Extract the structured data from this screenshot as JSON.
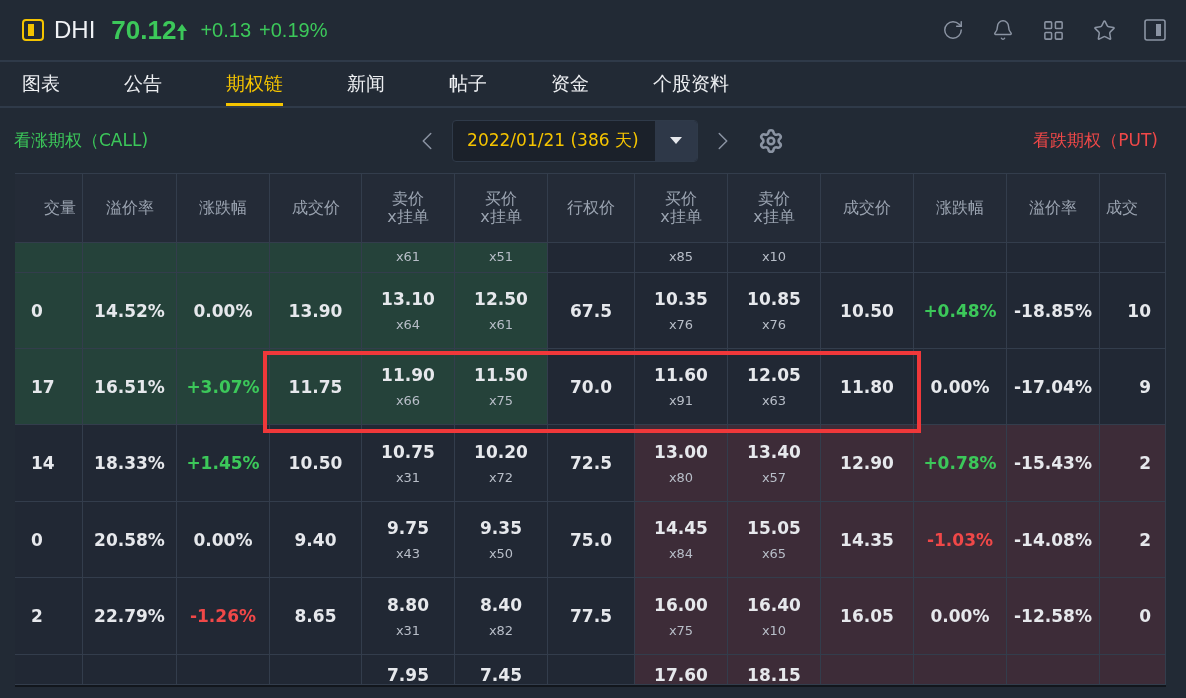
{
  "quote": {
    "symbol": "DHI",
    "price": "70.12",
    "rising": true,
    "color": "#3cc85a",
    "change": "+0.13",
    "change_percent": "+0.19%"
  },
  "tabs": [
    {
      "label": "图表",
      "selected": false
    },
    {
      "label": "公告",
      "selected": false
    },
    {
      "label": "期权链",
      "selected": true
    },
    {
      "label": "新闻",
      "selected": false
    },
    {
      "label": "帖子",
      "selected": false
    },
    {
      "label": "资金",
      "selected": false
    },
    {
      "label": "个股资料",
      "selected": false
    }
  ],
  "toolbar": {
    "call_label": "看涨期权（CALL)",
    "expiry": "2022/01/21 (386 天)",
    "put_label": "看跌期权（PUT)"
  },
  "table": {
    "columns": [
      {
        "label": "交量"
      },
      {
        "label": "溢价率"
      },
      {
        "label": "涨跌幅"
      },
      {
        "label": "成交价"
      },
      {
        "label": "卖价\nx挂单"
      },
      {
        "label": "买价\nx挂单"
      },
      {
        "label": "行权价"
      },
      {
        "label": "买价\nx挂单"
      },
      {
        "label": "卖价\nx挂单"
      },
      {
        "label": "成交价"
      },
      {
        "label": "涨跌幅"
      },
      {
        "label": "溢价率"
      },
      {
        "label": "成交"
      }
    ],
    "rows": [
      {
        "kind": "top_cut",
        "call_itm": true,
        "put_itm": false,
        "call": {
          "ask": {
            "size": "x61"
          },
          "bid": {
            "size": "x51"
          }
        },
        "put": {
          "bid": {
            "size": "x85"
          },
          "ask": {
            "size": "x10"
          }
        }
      },
      {
        "kind": "full",
        "call_itm": true,
        "put_itm": false,
        "call": {
          "volume": "0",
          "premium": "14.52%",
          "change": {
            "text": "0.00%",
            "color": "#e6e8ec"
          },
          "last": "13.90",
          "ask": {
            "price": "13.10",
            "size": "x64"
          },
          "bid": {
            "price": "12.50",
            "size": "x61"
          }
        },
        "strike": "67.5",
        "put": {
          "bid": {
            "price": "10.35",
            "size": "x76"
          },
          "ask": {
            "price": "10.85",
            "size": "x76"
          },
          "last": "10.50",
          "change": {
            "text": "+0.48%",
            "color": "#3cc85a"
          },
          "premium": "-18.85%",
          "volume": "10"
        }
      },
      {
        "kind": "full",
        "call_itm": true,
        "put_itm": false,
        "highlighted": true,
        "call": {
          "volume": "17",
          "premium": "16.51%",
          "change": {
            "text": "+3.07%",
            "color": "#3cc85a"
          },
          "last": "11.75",
          "ask": {
            "price": "11.90",
            "size": "x66"
          },
          "bid": {
            "price": "11.50",
            "size": "x75"
          }
        },
        "strike": "70.0",
        "put": {
          "bid": {
            "price": "11.60",
            "size": "x91"
          },
          "ask": {
            "price": "12.05",
            "size": "x63"
          },
          "last": "11.80",
          "change": {
            "text": "0.00%",
            "color": "#e6e8ec"
          },
          "premium": "-17.04%",
          "volume": "9"
        }
      },
      {
        "kind": "full",
        "call_itm": false,
        "put_itm": true,
        "call": {
          "volume": "14",
          "premium": "18.33%",
          "change": {
            "text": "+1.45%",
            "color": "#3cc85a"
          },
          "last": "10.50",
          "ask": {
            "price": "10.75",
            "size": "x31"
          },
          "bid": {
            "price": "10.20",
            "size": "x72"
          }
        },
        "strike": "72.5",
        "put": {
          "bid": {
            "price": "13.00",
            "size": "x80"
          },
          "ask": {
            "price": "13.40",
            "size": "x57"
          },
          "last": "12.90",
          "change": {
            "text": "+0.78%",
            "color": "#3cc85a"
          },
          "premium": "-15.43%",
          "volume": "2"
        }
      },
      {
        "kind": "full",
        "call_itm": false,
        "put_itm": true,
        "call": {
          "volume": "0",
          "premium": "20.58%",
          "change": {
            "text": "0.00%",
            "color": "#e6e8ec"
          },
          "last": "9.40",
          "ask": {
            "price": "9.75",
            "size": "x43"
          },
          "bid": {
            "price": "9.35",
            "size": "x50"
          }
        },
        "strike": "75.0",
        "put": {
          "bid": {
            "price": "14.45",
            "size": "x84"
          },
          "ask": {
            "price": "15.05",
            "size": "x65"
          },
          "last": "14.35",
          "change": {
            "text": "-1.03%",
            "color": "#f04848"
          },
          "premium": "-14.08%",
          "volume": "2"
        }
      },
      {
        "kind": "full",
        "call_itm": false,
        "put_itm": true,
        "call": {
          "volume": "2",
          "premium": "22.79%",
          "change": {
            "text": "-1.26%",
            "color": "#f04848"
          },
          "last": "8.65",
          "ask": {
            "price": "8.80",
            "size": "x31"
          },
          "bid": {
            "price": "8.40",
            "size": "x82"
          }
        },
        "strike": "77.5",
        "put": {
          "bid": {
            "price": "16.00",
            "size": "x75"
          },
          "ask": {
            "price": "16.40",
            "size": "x10"
          },
          "last": "16.05",
          "change": {
            "text": "0.00%",
            "color": "#e6e8ec"
          },
          "premium": "-12.58%",
          "volume": "0"
        }
      },
      {
        "kind": "bottom_cut",
        "call_itm": false,
        "put_itm": true,
        "call": {
          "ask": {
            "price": "7.95"
          },
          "bid": {
            "price": "7.45"
          }
        },
        "put": {
          "bid": {
            "price": "17.60"
          },
          "ask": {
            "price": "18.15"
          }
        }
      }
    ]
  }
}
